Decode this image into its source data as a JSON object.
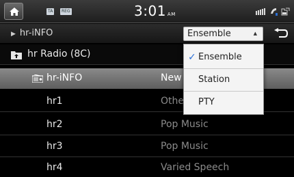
{
  "statusbar": {
    "tag_ta": "TA",
    "tag_reg": "REG",
    "time": "3:01",
    "ampm": "AM",
    "icons": [
      "signal-icon",
      "phone-icon",
      "battery-icon"
    ]
  },
  "source": {
    "label": "hr-iNFO",
    "dropdown_value": "Ensemble"
  },
  "list": {
    "folder": "hr Radio (8C)",
    "selected": {
      "name": "hr-iNFO",
      "genre": "New"
    },
    "rows": [
      {
        "name": "hr1",
        "genre": "Othe"
      },
      {
        "name": "hr2",
        "genre": "Pop Music"
      },
      {
        "name": "hr3",
        "genre": "Pop Music"
      },
      {
        "name": "hr4",
        "genre": "Varied Speech"
      }
    ]
  },
  "menu": {
    "items": [
      {
        "label": "Ensemble",
        "checked": true
      },
      {
        "label": "Station",
        "checked": false
      },
      {
        "label": "PTY",
        "checked": false
      }
    ]
  },
  "colors": {
    "accent_check": "#2b6fd6",
    "selected_row": "#7a7a7a",
    "background": "#000000"
  }
}
